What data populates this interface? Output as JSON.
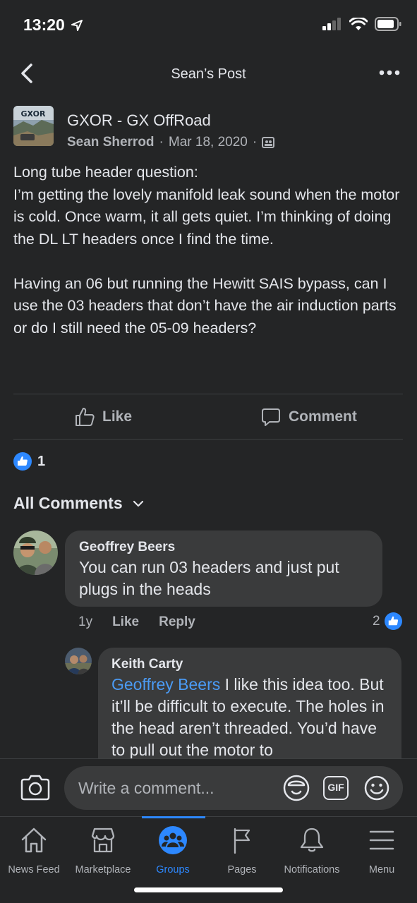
{
  "status_bar": {
    "time": "13:20"
  },
  "header": {
    "title": "Sean’s Post"
  },
  "post": {
    "group_name": "GXOR - GX OffRoad",
    "author": "Sean Sherrod",
    "date": "Mar 18, 2020",
    "separator": "·",
    "body_p1": "Long tube header question:\nI’m getting the lovely manifold leak sound when the motor is cold. Once warm, it all gets quiet. I’m thinking of doing the DL LT headers once I find the time.",
    "body_p2": "Having an 06 but running the Hewitt SAIS bypass, can I use the 03 headers that don’t have the air induction parts or do I still need the 05-09 headers?",
    "like_label": "Like",
    "comment_label": "Comment",
    "reaction_count": "1"
  },
  "comments_header": {
    "label": "All Comments"
  },
  "comments": [
    {
      "author": "Geoffrey Beers",
      "text": "You can run 03 headers and just put plugs in the heads",
      "age": "1y",
      "like_label": "Like",
      "reply_label": "Reply",
      "likes": "2"
    },
    {
      "author": "Keith Carty",
      "mention": "Geoffrey Beers",
      "text": " I like this idea too. But it’ll be difficult to execute. The holes in the head aren’t threaded. You’d have to pull out the motor to"
    }
  ],
  "composer": {
    "placeholder": "Write a comment...",
    "gif_label": "GIF"
  },
  "tabs": [
    {
      "label": "News Feed",
      "icon": "home-icon"
    },
    {
      "label": "Marketplace",
      "icon": "marketplace-icon"
    },
    {
      "label": "Groups",
      "icon": "groups-icon",
      "active": true
    },
    {
      "label": "Pages",
      "icon": "flag-icon"
    },
    {
      "label": "Notifications",
      "icon": "bell-icon"
    },
    {
      "label": "Menu",
      "icon": "menu-icon"
    }
  ],
  "colors": {
    "background": "#242526",
    "bubble": "#3a3b3c",
    "accent": "#2d88ff",
    "mention": "#4b9bf5",
    "muted": "#b0b3b8"
  }
}
